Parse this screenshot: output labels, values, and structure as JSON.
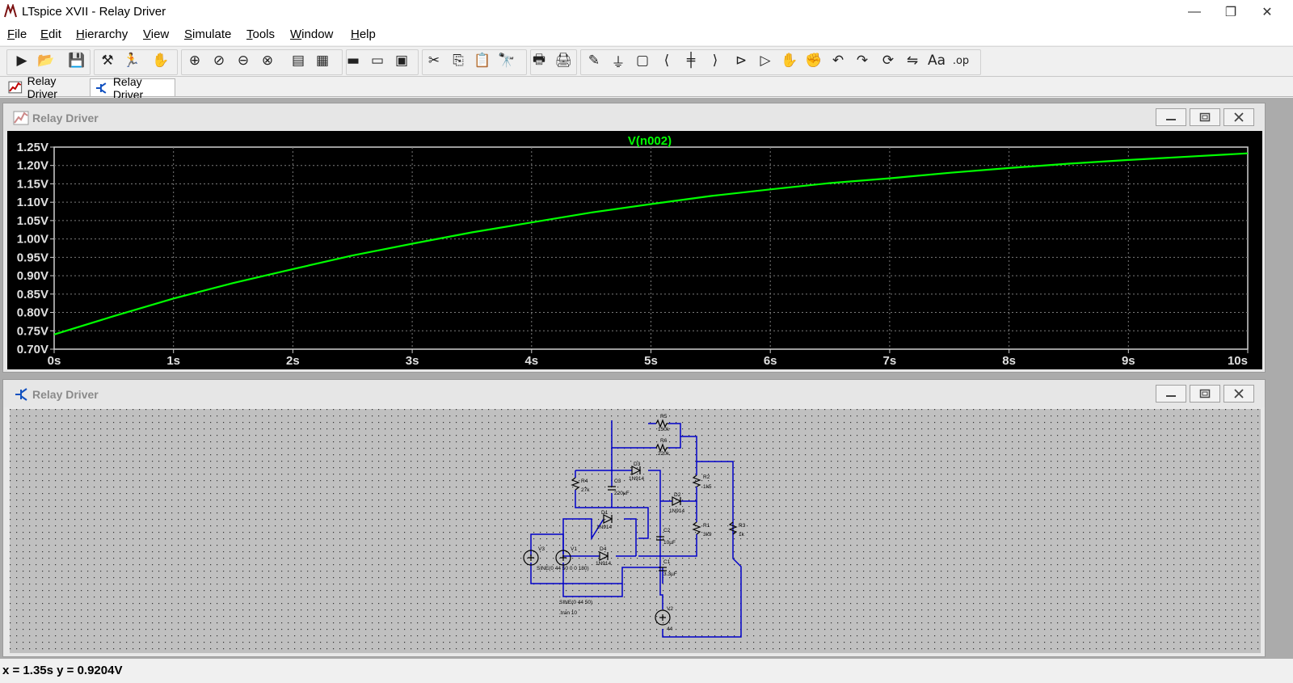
{
  "window": {
    "title": "LTspice XVII - Relay Driver",
    "minimize": "—",
    "restore": "❐",
    "close": "✕"
  },
  "menu": [
    {
      "label": "File",
      "u": "F",
      "rest": "ile"
    },
    {
      "label": "Edit",
      "u": "E",
      "rest": "dit"
    },
    {
      "label": "Hierarchy",
      "u": "H",
      "rest": "ierarchy"
    },
    {
      "label": "View",
      "u": "V",
      "rest": "iew"
    },
    {
      "label": "Simulate",
      "u": "S",
      "rest": "imulate"
    },
    {
      "label": "Tools",
      "u": "T",
      "rest": "ools"
    },
    {
      "label": "Window",
      "u": "W",
      "rest": "indow"
    },
    {
      "label": "Help",
      "u": "H",
      "rest": "elp"
    }
  ],
  "toolbar": {
    "icons": [
      "run-icon",
      "open-icon",
      "save-icon",
      "control-panel-icon",
      "halt-icon",
      "pan-icon",
      "zoom-in-icon",
      "zoom-full-icon",
      "zoom-out-icon",
      "zoom-cancel-icon",
      "autorange-icon",
      "mark-unref-icon",
      "tile-horizontal-icon",
      "tile-vertical-icon",
      "cascade-icon",
      "cut-icon",
      "copy-icon",
      "paste-icon",
      "find-icon",
      "print-setup-icon",
      "print-icon",
      "draw-wire-icon",
      "ground-icon",
      "label-net-icon",
      "resistor-icon",
      "capacitor-icon",
      "inductor-icon",
      "diode-icon",
      "component-icon",
      "move-icon",
      "drag-icon",
      "undo-icon",
      "redo-icon",
      "rotate-icon",
      "mirror-icon",
      "text-icon",
      "spice-directive-icon"
    ]
  },
  "tabs": [
    {
      "label": "Relay Driver",
      "kind": "waveform"
    },
    {
      "label": "Relay Driver",
      "kind": "schematic"
    }
  ],
  "plot_window": {
    "caption": "Relay Driver"
  },
  "schematic_window": {
    "caption": "Relay Driver",
    "labels": {
      "R5": "R5",
      "R5v": "150k",
      "R6": "R6",
      "R6v": "220k",
      "D3": "D3",
      "D3v": "1N914",
      "R4": "R4",
      "R4v": "27k",
      "C3": "C3",
      "C3v": "220µF",
      "R2": "R2",
      "R2v": "1k5",
      "D2": "D2",
      "D2v": "1N914",
      "D1": "D1",
      "D1v": "1N914",
      "C2": "C2",
      "C2v": "10µF",
      "R1": "R1",
      "R1v": "3k9",
      "R3": "R3",
      "R3v": "1k",
      "V3": "V3",
      "V1": "V1",
      "D4": "D4",
      "D4v": "1N914",
      "C1": "C1",
      "C1v": "3.3µF",
      "V3v": "SINE(0 44 50 0 0 180)",
      "V1v": "SINE(0 44 50)",
      "tran": ".tran 10",
      "V2": "V2",
      "V2v": "44"
    }
  },
  "status": {
    "text": "x = 1.35s    y = 0.9204V"
  },
  "colors": {
    "trace": "#00ff00",
    "plot_bg": "#000000",
    "grid": "#808080",
    "wire": "#0000c8",
    "sheet_bg": "#c0c0c0"
  },
  "chart_data": {
    "type": "line",
    "title": "V(n002)",
    "xlabel": "",
    "ylabel": "",
    "xlim": [
      0,
      10
    ],
    "ylim": [
      0.7,
      1.25
    ],
    "x_ticks": [
      "0s",
      "1s",
      "2s",
      "3s",
      "4s",
      "5s",
      "6s",
      "7s",
      "8s",
      "9s",
      "10s"
    ],
    "y_ticks": [
      "1.25V",
      "1.20V",
      "1.15V",
      "1.10V",
      "1.05V",
      "1.00V",
      "0.95V",
      "0.90V",
      "0.85V",
      "0.80V",
      "0.75V",
      "0.70V"
    ],
    "grid": true,
    "series": [
      {
        "name": "V(n002)",
        "x": [
          0,
          0.5,
          1,
          1.5,
          2,
          2.5,
          3,
          3.5,
          4,
          4.5,
          5,
          5.5,
          6,
          6.5,
          7,
          7.5,
          8,
          8.5,
          9,
          9.5,
          10
        ],
        "y": [
          0.74,
          0.79,
          0.838,
          0.88,
          0.918,
          0.955,
          0.987,
          1.018,
          1.045,
          1.072,
          1.095,
          1.117,
          1.135,
          1.152,
          1.165,
          1.18,
          1.193,
          1.205,
          1.215,
          1.224,
          1.233
        ]
      }
    ]
  }
}
